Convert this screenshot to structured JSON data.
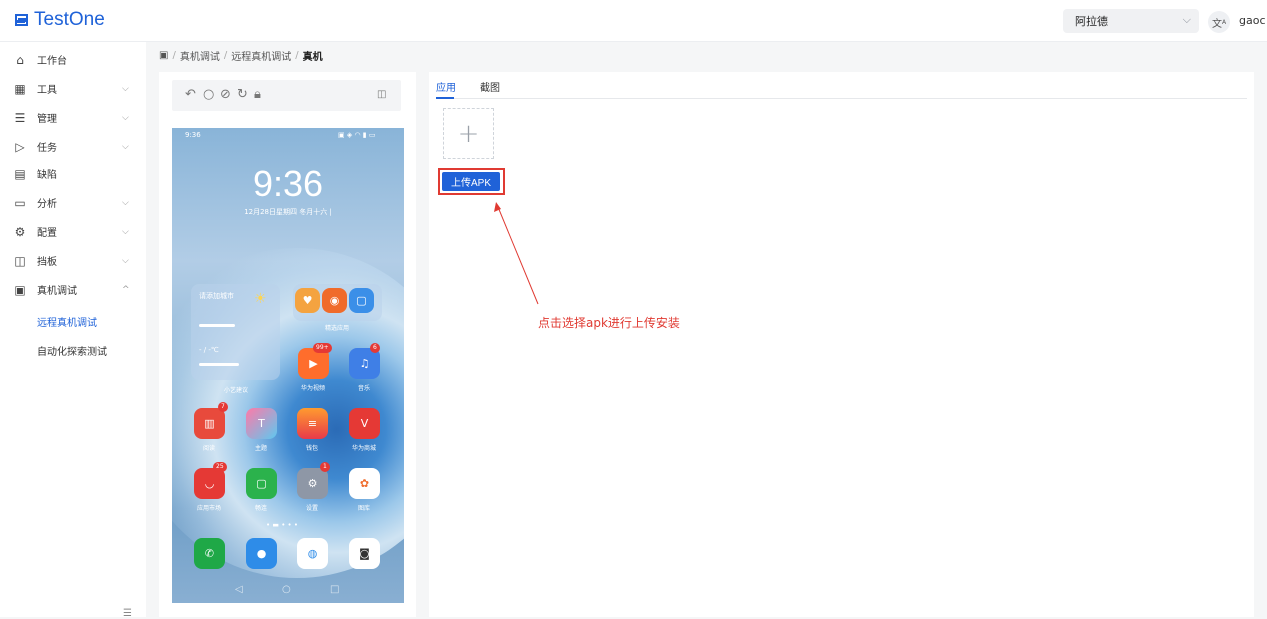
{
  "header": {
    "logo_text": "TestOne",
    "project_select": "阿拉德",
    "lang_icon": "translate-icon",
    "user": "gaoc"
  },
  "sidebar": {
    "items": [
      {
        "label": "工作台",
        "icon": "home-icon"
      },
      {
        "label": "工具",
        "icon": "grid-icon"
      },
      {
        "label": "管理",
        "icon": "list-icon"
      },
      {
        "label": "任务",
        "icon": "play-icon"
      },
      {
        "label": "缺陷",
        "icon": "doc-icon"
      },
      {
        "label": "分析",
        "icon": "calendar-icon"
      },
      {
        "label": "配置",
        "icon": "gear-icon"
      },
      {
        "label": "挡板",
        "icon": "panel-icon"
      },
      {
        "label": "真机调试",
        "icon": "device-icon"
      }
    ],
    "sub_items": [
      {
        "label": "远程真机调试",
        "active": true
      },
      {
        "label": "自动化探索测试",
        "active": false
      }
    ]
  },
  "breadcrumb": [
    "真机调试",
    "远程真机调试",
    "真机"
  ],
  "device": {
    "status_time": "9:36",
    "clock": "9:36",
    "date": "12月28日星期四  冬月十六  |",
    "weather_city": "请添加城市",
    "weather_temp": "- / -℃",
    "widget1_label": "小艺建议",
    "widget2_label": "精选应用",
    "apps": [
      {
        "label": "华为视频",
        "badge": "99+"
      },
      {
        "label": "音乐",
        "badge": "6"
      },
      {
        "label": "阅读",
        "badge": "7"
      },
      {
        "label": "主题",
        "badge": ""
      },
      {
        "label": "钱包",
        "badge": ""
      },
      {
        "label": "华为商城",
        "badge": ""
      },
      {
        "label": "应用市场",
        "badge": "25"
      },
      {
        "label": "畅连",
        "badge": ""
      },
      {
        "label": "设置",
        "badge": "1"
      },
      {
        "label": "图库",
        "badge": ""
      }
    ],
    "dock": [
      "phone-icon",
      "message-icon",
      "browser-icon",
      "camera-icon"
    ]
  },
  "panel": {
    "tabs": [
      {
        "label": "应用",
        "active": true
      },
      {
        "label": "截图",
        "active": false
      }
    ],
    "upload_button": "上传APK",
    "annotation": "点击选择apk进行上传安装"
  },
  "colors": {
    "accent": "#1f62d8",
    "annotation": "#e03a32"
  }
}
